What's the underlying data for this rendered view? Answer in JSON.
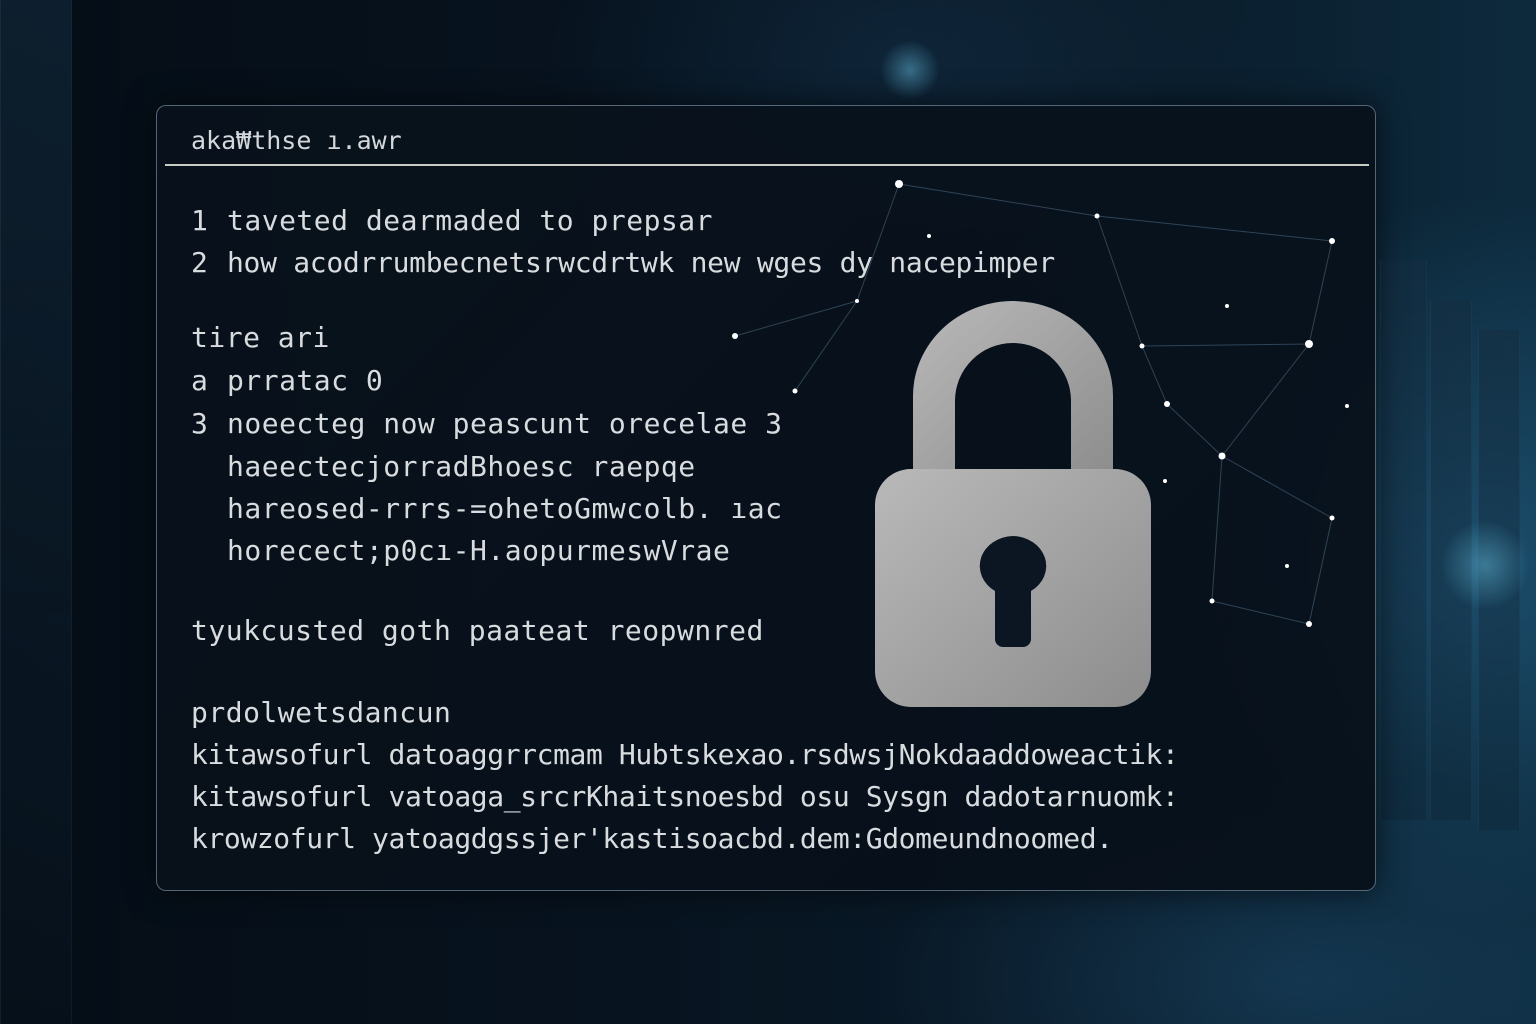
{
  "window": {
    "title": "aka₩thse ı.awr"
  },
  "list_top": [
    {
      "num": "1",
      "text": "taveted dearmaded to prepsar"
    },
    {
      "num": "2",
      "text": "how acodrrumbecnetsrwcdrtwk new wges dy nacepimper"
    }
  ],
  "section_a": {
    "heading": "tire ari",
    "items": [
      {
        "num": "a",
        "text": "prratac 0"
      },
      {
        "num": "3",
        "text": "noeecteg now peascunt orecelae 3"
      }
    ],
    "sub_items": [
      "haeectecjorradBhoesc raepqe",
      "hareosed-rrrs-=ohetoGmwcolb. ıac",
      "horecect;p0cı-H.aopurmeswVrae"
    ]
  },
  "section_b": {
    "text": "tyukcusted goth paateat reopwnred"
  },
  "section_c": {
    "heading": "prdolwetsdancun",
    "lines": [
      "kitawsofurl datoaggrrcmam Hubtskexao.rsdwsjNokdaaddoweactik:",
      "kitawsofurl vatoaga_srcrKhaitsnoesbd osu Sysgn dadotarnuomk:",
      "krowzofurl yatoagdgssjer'kastisoacbd.dem:Gdomeundnoomed."
    ]
  },
  "icons": {
    "lock": "padlock-icon"
  },
  "colors": {
    "background": "#06111c",
    "panel": "#09121c",
    "text": "#d9dcdf",
    "lock": "#a8a8a8",
    "accent": "#2f6e94"
  }
}
